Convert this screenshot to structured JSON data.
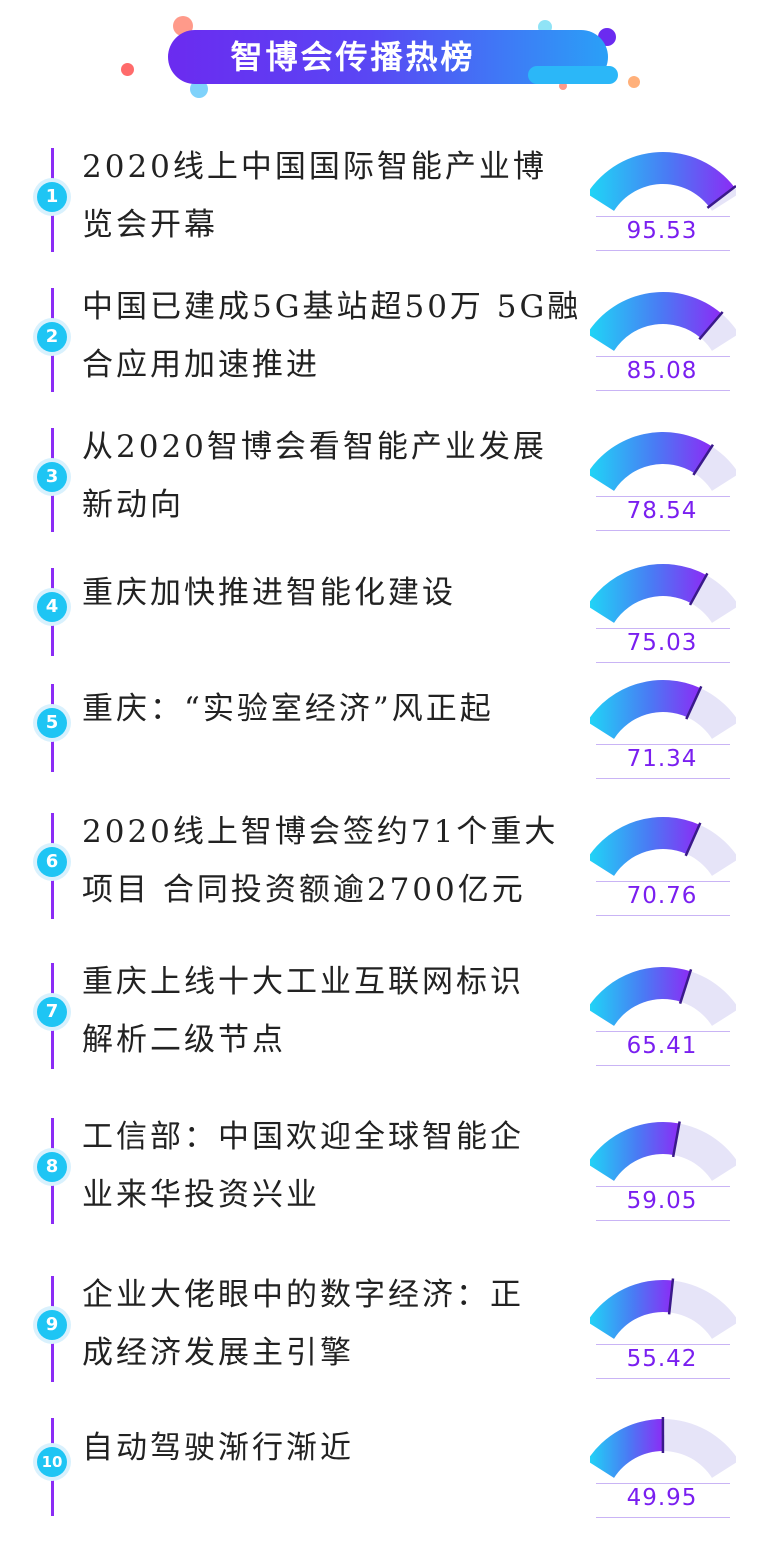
{
  "header": {
    "title": "智博会传播热榜"
  },
  "colors": {
    "accent_purple": "#7a1ff0",
    "accent_cyan": "#1ec5f4",
    "gauge_track": "#e6e4f8"
  },
  "gauge_max": 100,
  "items": [
    {
      "rank": "1",
      "title_line1": "2020线上中国国际智能产业博",
      "title_line2": "览会开幕",
      "score": "95.53",
      "value": 95.53
    },
    {
      "rank": "2",
      "title_line1": "中国已建成5G基站超50万 5G融",
      "title_line2": "合应用加速推进",
      "score": "85.08",
      "value": 85.08
    },
    {
      "rank": "3",
      "title_line1": "从2020智博会看智能产业发展",
      "title_line2": "新动向",
      "score": "78.54",
      "value": 78.54
    },
    {
      "rank": "4",
      "title_line1": "重庆加快推进智能化建设",
      "title_line2": "",
      "score": "75.03",
      "value": 75.03
    },
    {
      "rank": "5",
      "title_line1": "重庆：“实验室经济”风正起",
      "title_line2": "",
      "score": "71.34",
      "value": 71.34
    },
    {
      "rank": "6",
      "title_line1": "2020线上智博会签约71个重大",
      "title_line2": "项目 合同投资额逾2700亿元",
      "score": "70.76",
      "value": 70.76
    },
    {
      "rank": "7",
      "title_line1": "重庆上线十大工业互联网标识",
      "title_line2": "解析二级节点",
      "score": "65.41",
      "value": 65.41
    },
    {
      "rank": "8",
      "title_line1": "工信部：中国欢迎全球智能企",
      "title_line2": "业来华投资兴业",
      "score": "59.05",
      "value": 59.05
    },
    {
      "rank": "9",
      "title_line1": "企业大佬眼中的数字经济：正",
      "title_line2": "成经济发展主引擎",
      "score": "55.42",
      "value": 55.42
    },
    {
      "rank": "10",
      "title_line1": "自动驾驶渐行渐近",
      "title_line2": "",
      "score": "49.95",
      "value": 49.95
    }
  ]
}
